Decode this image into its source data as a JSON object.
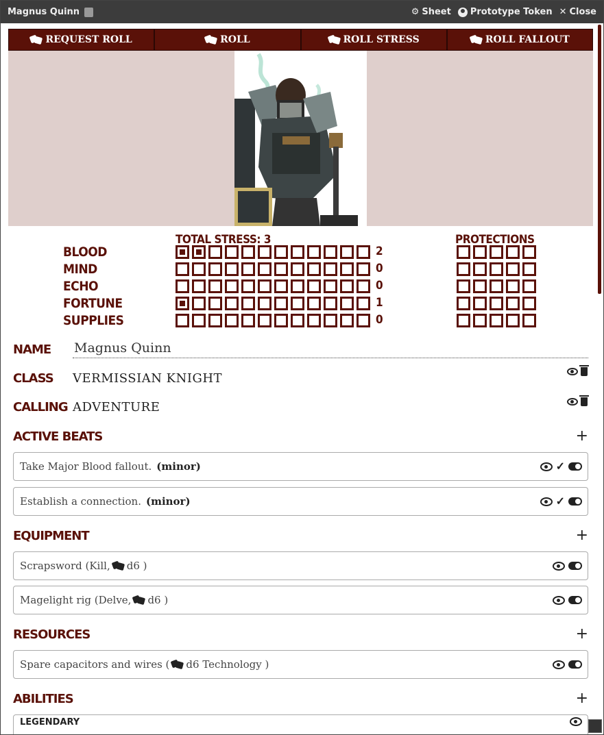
{
  "window": {
    "title": "Magnus Quinn",
    "sheet_label": "Sheet",
    "token_label": "Prototype Token",
    "close_label": "Close"
  },
  "rolls": [
    "REQUEST ROLL",
    "ROLL",
    "ROLL STRESS",
    "ROLL FALLOUT"
  ],
  "stress": {
    "total_label": "TOTAL STRESS: 3",
    "protections_label": "PROTECTIONS",
    "rows": [
      {
        "label": "BLOOD",
        "filled": 2,
        "value": "2"
      },
      {
        "label": "MIND",
        "filled": 0,
        "value": "0"
      },
      {
        "label": "ECHO",
        "filled": 0,
        "value": "0"
      },
      {
        "label": "FORTUNE",
        "filled": 1,
        "value": "1"
      },
      {
        "label": "SUPPLIES",
        "filled": 0,
        "value": "0"
      }
    ]
  },
  "fields": {
    "name_label": "NAME",
    "name_value": "Magnus Quinn",
    "class_label": "CLASS",
    "class_value": "VERMISSIAN KNIGHT",
    "calling_label": "CALLING",
    "calling_value": "ADVENTURE"
  },
  "sections": {
    "beats_title": "ACTIVE BEATS",
    "beats": [
      {
        "text": "Take Major Blood fallout.",
        "tag": "(minor)"
      },
      {
        "text": "Establish a connection.",
        "tag": "(minor)"
      }
    ],
    "equipment_title": "EQUIPMENT",
    "equipment": [
      {
        "pre": "Scrapsword (Kill,",
        "post": "d6 )"
      },
      {
        "pre": "Magelight rig (Delve,",
        "post": "d6 )"
      }
    ],
    "resources_title": "RESOURCES",
    "resources": [
      {
        "pre": "Spare capacitors and wires (",
        "post": "d6 Technology )"
      }
    ],
    "abilities_title": "ABILITIES",
    "abilities_first": "LEGENDARY"
  },
  "colors": {
    "accent": "#5a1108",
    "portrait_bg": "#dfcfcc"
  }
}
